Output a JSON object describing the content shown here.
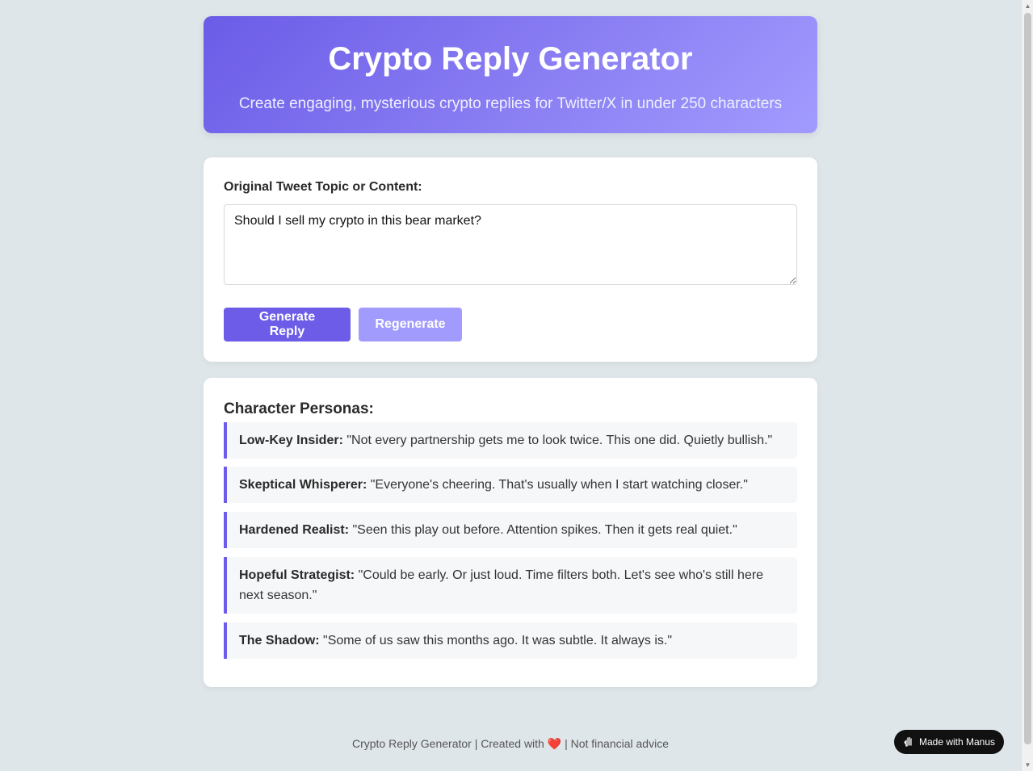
{
  "header": {
    "title": "Crypto Reply Generator",
    "subtitle": "Create engaging, mysterious crypto replies for Twitter/X in under 250 characters"
  },
  "input": {
    "label": "Original Tweet Topic or Content:",
    "value": "Should I sell my crypto in this bear market?"
  },
  "buttons": {
    "generate": "Generate Reply",
    "regenerate": "Regenerate"
  },
  "personas": {
    "title": "Character Personas:",
    "items": [
      {
        "name": "Low-Key Insider:",
        "quote": "\"Not every partnership gets me to look twice. This one did. Quietly bullish.\""
      },
      {
        "name": "Skeptical Whisperer:",
        "quote": "\"Everyone's cheering. That's usually when I start watching closer.\""
      },
      {
        "name": "Hardened Realist:",
        "quote": "\"Seen this play out before. Attention spikes. Then it gets real quiet.\""
      },
      {
        "name": "Hopeful Strategist:",
        "quote": "\"Could be early. Or just loud. Time filters both. Let's see who's still here next season.\""
      },
      {
        "name": "The Shadow:",
        "quote": "\"Some of us saw this months ago. It was subtle. It always is.\""
      }
    ]
  },
  "footer": {
    "part1": "Crypto Reply Generator | Created with",
    "heart": "❤️",
    "part2": "| Not financial advice"
  },
  "badge": {
    "label": "Made with Manus",
    "icon": "manus-hand-icon"
  },
  "colors": {
    "accent": "#6c5ce7",
    "accent_light": "#a29bfe",
    "background": "#dfe6ea"
  }
}
